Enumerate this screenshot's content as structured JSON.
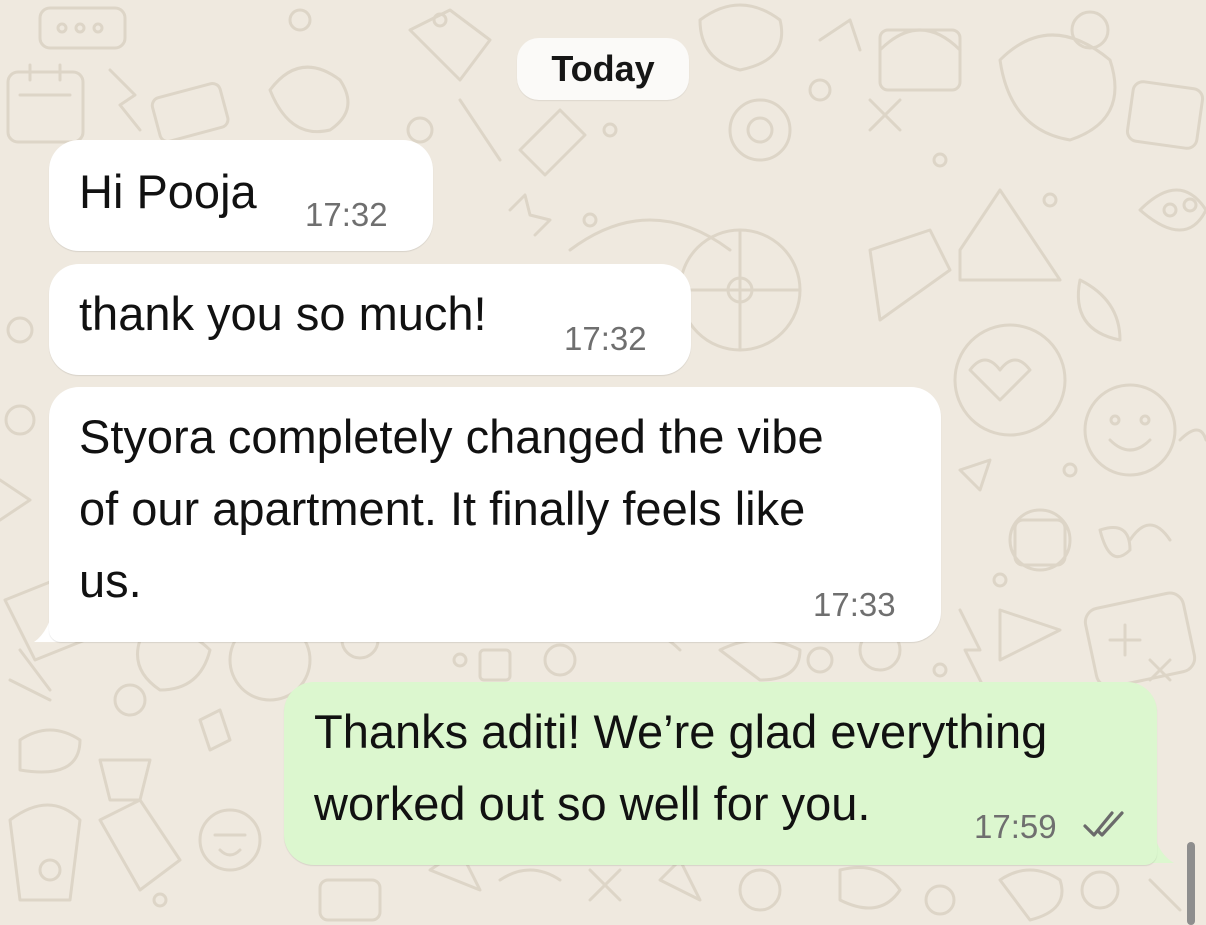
{
  "chat": {
    "date_label": "Today",
    "messages": [
      {
        "direction": "incoming",
        "lines": [
          "Hi Pooja"
        ],
        "time": "17:32"
      },
      {
        "direction": "incoming",
        "lines": [
          "thank you so much!"
        ],
        "time": "17:32"
      },
      {
        "direction": "incoming",
        "lines": [
          "Styora completely changed the vibe",
          "of our apartment. It finally feels like",
          "us."
        ],
        "time": "17:33"
      },
      {
        "direction": "outgoing",
        "lines": [
          "Thanks aditi! We’re glad everything",
          "worked out so well for you."
        ],
        "time": "17:59",
        "status_icon": "double-check-icon"
      }
    ]
  },
  "colors": {
    "wallpaper": "#efe9df",
    "incoming_bubble": "#ffffff",
    "outgoing_bubble": "#dcf7cf",
    "timestamp": "#6f6f6f"
  }
}
